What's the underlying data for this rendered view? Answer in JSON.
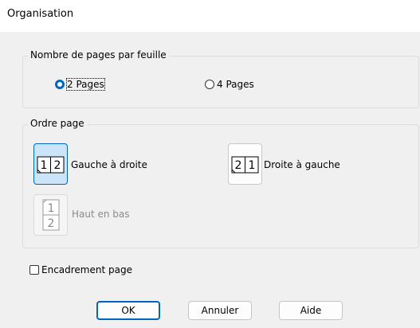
{
  "window": {
    "title": "Organisation"
  },
  "pages_per_sheet": {
    "legend": "Nombre de pages par feuille",
    "options": [
      {
        "label": "2 Pages",
        "checked": true
      },
      {
        "label": "4 Pages",
        "checked": false
      }
    ]
  },
  "page_order": {
    "legend": "Ordre page",
    "options": [
      {
        "label": "Gauche à droite",
        "state": "selected",
        "numbers": [
          "1",
          "2"
        ]
      },
      {
        "label": "Droite à gauche",
        "state": "enabled",
        "numbers": [
          "2",
          "1"
        ]
      },
      {
        "label": "Haut en bas",
        "state": "disabled",
        "numbers": [
          "1",
          "2"
        ]
      }
    ]
  },
  "frame": {
    "label": "Encadrement page",
    "checked": false
  },
  "buttons": {
    "ok": "OK",
    "cancel": "Annuler",
    "help": "Aide"
  },
  "colors": {
    "accent": "#0067c0",
    "selected_bg": "#cce4f7",
    "disabled_text": "#8a8a8a"
  }
}
